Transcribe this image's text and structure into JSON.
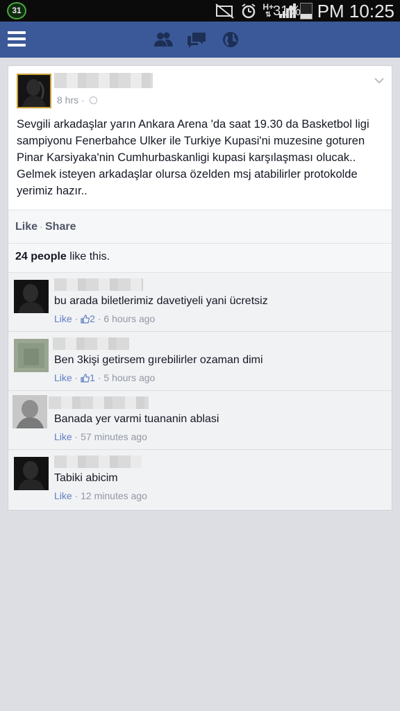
{
  "status_bar": {
    "calendar_day": "31",
    "network": "H+",
    "battery_percent": "31%",
    "battery_level": 0.31,
    "time": "PM 10:25",
    "icons": [
      "calendar-icon",
      "mute-icon",
      "alarm-icon",
      "network-h-plus-icon",
      "signal-icon",
      "battery-icon"
    ]
  },
  "top_bar": {
    "color": "#3b5998",
    "icons": [
      "menu-icon",
      "friend-requests-icon",
      "messages-icon",
      "notifications-globe-icon"
    ]
  },
  "post": {
    "author_name_hidden": true,
    "time": "8 hrs",
    "separator": "·",
    "text": "Sevgili arkadaşlar yarın Ankara Arena 'da saat 19.30 da Basketbol ligi sampiyonu Fenerbahce Ulker ile Turkiye Kupasi'ni muzesine goturen Pinar Karsiyaka'nin Cumhurbaskanligi kupasi karşılaşması olucak.. Gelmek isteyen arkadaşlar olursa özelden msj atabilirler protokolde yerimiz hazır..",
    "actions": {
      "like": "Like",
      "separator": "·",
      "share": "Share"
    },
    "likes": {
      "count": "24 people",
      "suffix": " like this."
    }
  },
  "comments": [
    {
      "text": "bu arada biletlerimiz davetiyeli yani ücretsiz",
      "like": "Like",
      "sep": " · ",
      "likes_count": "2",
      "time": "6 hours ago",
      "avatar": "dark"
    },
    {
      "text": "Ben 3kişi getirsem gırebilirler ozaman dimi",
      "like": "Like",
      "sep": " · ",
      "likes_count": "1",
      "time": "5 hours ago",
      "avatar": "green"
    },
    {
      "text": "Banada yer varmi tuananin ablasi",
      "like": "Like",
      "sep": " · ",
      "likes_count": "",
      "time": "57 minutes ago",
      "avatar": "gray"
    },
    {
      "text": "Tabiki abicim",
      "like": "Like",
      "sep": " · ",
      "likes_count": "",
      "time": "12 minutes ago",
      "avatar": "dark"
    }
  ]
}
